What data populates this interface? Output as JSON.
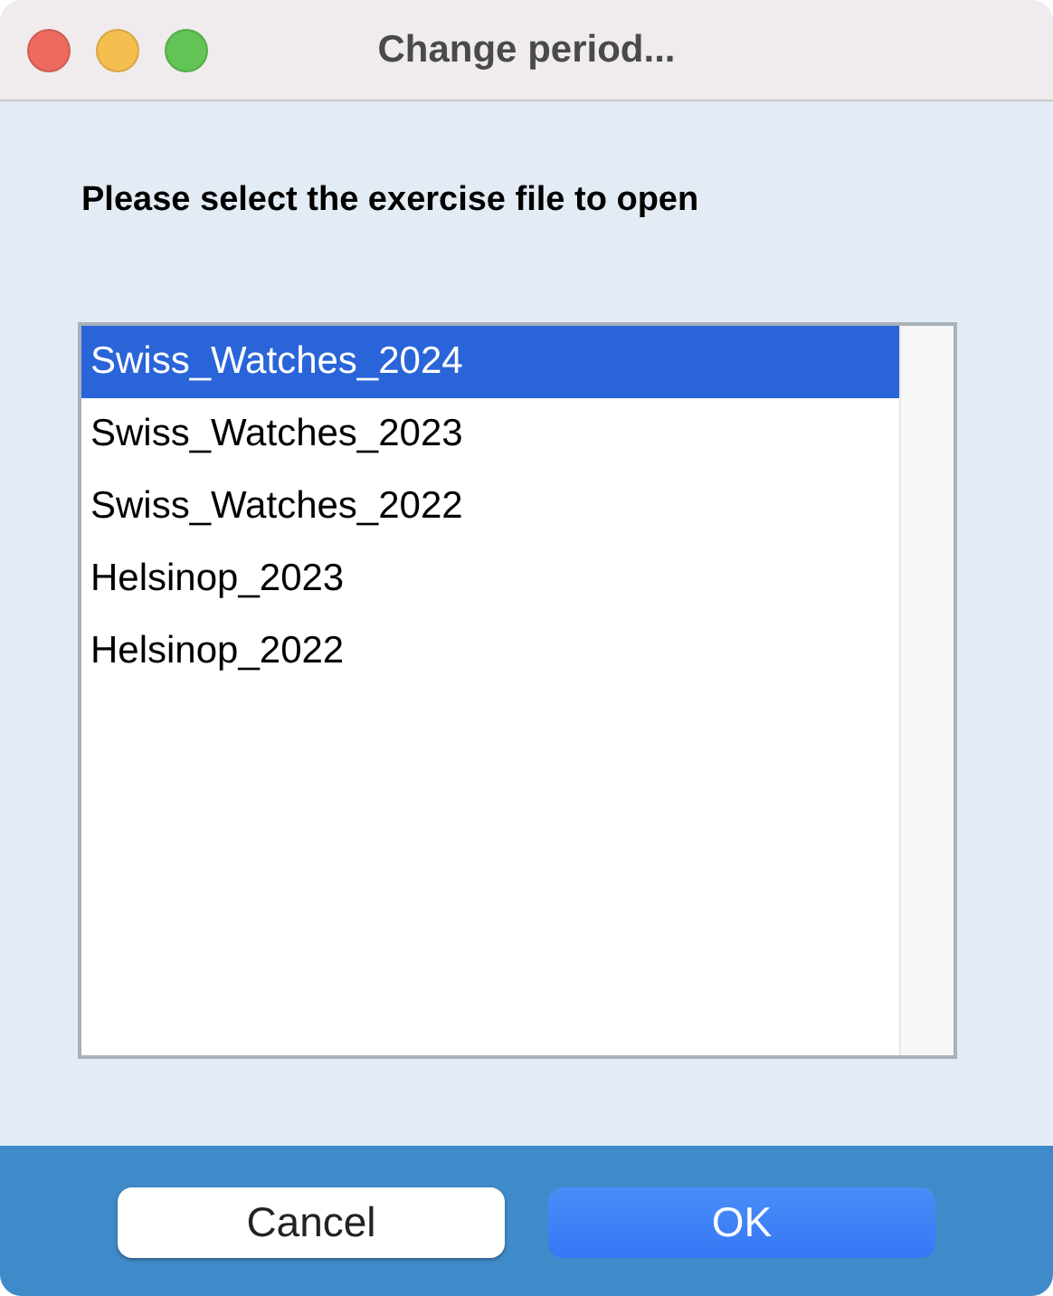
{
  "window": {
    "title": "Change period..."
  },
  "prompt": "Please select the exercise file to open",
  "files": [
    {
      "name": "Swiss_Watches_2024",
      "selected": true
    },
    {
      "name": "Swiss_Watches_2023",
      "selected": false
    },
    {
      "name": "Swiss_Watches_2022",
      "selected": false
    },
    {
      "name": "Helsinop_2023",
      "selected": false
    },
    {
      "name": "Helsinop_2022",
      "selected": false
    }
  ],
  "buttons": [
    {
      "label": "Cancel",
      "kind": "normal"
    },
    {
      "label": "OK",
      "kind": "default"
    }
  ]
}
